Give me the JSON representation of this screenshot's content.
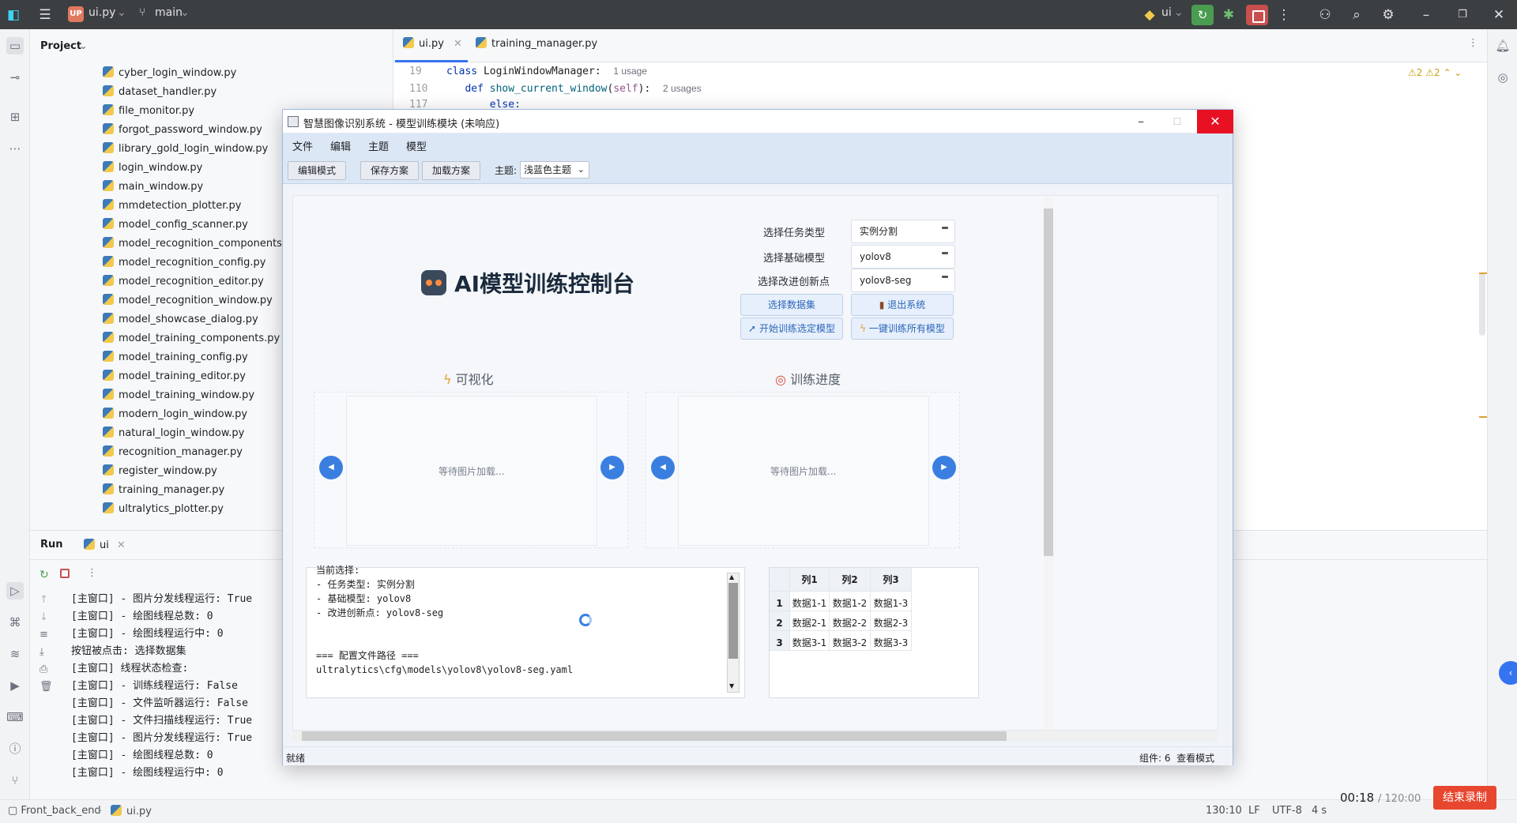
{
  "ide": {
    "project_badge": "UP",
    "file_name": "ui.py",
    "branch": "main",
    "run_config": "ui",
    "project_title": "Project"
  },
  "project_files": [
    "cyber_login_window.py",
    "dataset_handler.py",
    "file_monitor.py",
    "forgot_password_window.py",
    "library_gold_login_window.py",
    "login_window.py",
    "main_window.py",
    "mmdetection_plotter.py",
    "model_config_scanner.py",
    "model_recognition_components.py",
    "model_recognition_config.py",
    "model_recognition_editor.py",
    "model_recognition_window.py",
    "model_showcase_dialog.py",
    "model_training_components.py",
    "model_training_config.py",
    "model_training_editor.py",
    "model_training_window.py",
    "modern_login_window.py",
    "natural_login_window.py",
    "recognition_manager.py",
    "register_window.py",
    "training_manager.py",
    "ultralytics_plotter.py"
  ],
  "editor": {
    "tabs": [
      "ui.py",
      "training_manager.py"
    ],
    "lines": [
      {
        "no": "19",
        "kw": "class",
        "name": "LoginWindowManager:",
        "usage": "1 usage"
      },
      {
        "no": "110",
        "kw": "def",
        "name": "show_current_window",
        "usage": "2 usages"
      },
      {
        "no": "117",
        "text": "else:"
      }
    ],
    "warnings": "2",
    "weak_warnings": "2"
  },
  "run_panel": {
    "tab_run": "Run",
    "tab_ui": "ui",
    "console_lines": [
      "[主窗口] - 图片分发线程运行: True",
      "[主窗口] - 绘图线程总数: 0",
      "[主窗口] - 绘图线程运行中: 0",
      "按钮被点击: 选择数据集",
      "[主窗口] 线程状态检查:",
      "[主窗口] - 训练线程运行: False",
      "[主窗口] - 文件监听器运行: False",
      "[主窗口] - 文件扫描线程运行: True",
      "[主窗口] - 图片分发线程运行: True",
      "[主窗口] - 绘图线程总数: 0",
      "[主窗口] - 绘图线程运行中: 0"
    ]
  },
  "statusbar": {
    "project": "Front_back_end",
    "file": "ui.py",
    "position": "130:10",
    "line_sep": "LF",
    "encoding": "UTF-8",
    "indent": "4 s"
  },
  "recorder": {
    "elapsed": "00:18",
    "total": "/ 120:00",
    "stop_label": "结束录制"
  },
  "dialog": {
    "title": "智慧图像识别系统 - 模型训练模块 (未响应)",
    "menus": [
      "文件",
      "编辑",
      "主题",
      "模型"
    ],
    "toolbar": {
      "edit_mode": "编辑模式",
      "save_plan": "保存方案",
      "load_plan": "加载方案",
      "theme_label": "主题:",
      "theme_value": "浅蓝色主题"
    },
    "heading": "AI模型训练控制台",
    "form": [
      {
        "label": "选择任务类型",
        "value": "实例分割"
      },
      {
        "label": "选择基础模型",
        "value": "yolov8"
      },
      {
        "label": "选择改进创新点",
        "value": "yolov8-seg"
      }
    ],
    "buttons": {
      "select_dataset": "选择数据集",
      "exit": "退出系统",
      "train_selected": "开始训练选定模型",
      "train_all": "一键训练所有模型"
    },
    "sections": {
      "visualize": "可视化",
      "progress": "训练进度",
      "waiting": "等待图片加载..."
    },
    "log_lines": [
      "当前选择:",
      "- 任务类型: 实例分割",
      "- 基础模型: yolov8",
      "- 改进创新点: yolov8-seg",
      "",
      "",
      "=== 配置文件路径 ===",
      "ultralytics\\cfg\\models\\yolov8\\yolov8-seg.yaml"
    ],
    "table": {
      "headers": [
        "列1",
        "列2",
        "列3"
      ],
      "rows": [
        {
          "idx": "1",
          "cells": [
            "数据1-1",
            "数据1-2",
            "数据1-3"
          ]
        },
        {
          "idx": "2",
          "cells": [
            "数据2-1",
            "数据2-2",
            "数据2-3"
          ]
        },
        {
          "idx": "3",
          "cells": [
            "数据3-1",
            "数据3-2",
            "数据3-3"
          ]
        }
      ]
    },
    "status_left": "就绪",
    "status_right": "组件: 6  查看模式"
  }
}
